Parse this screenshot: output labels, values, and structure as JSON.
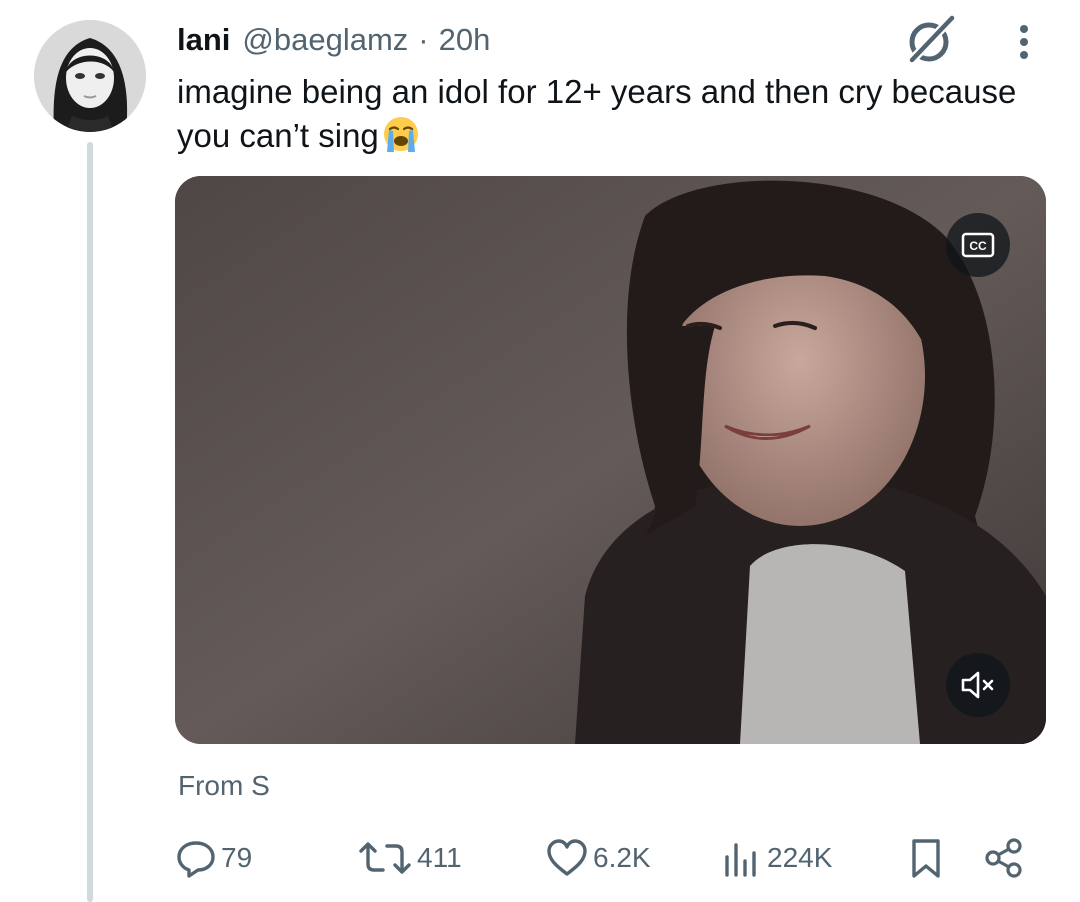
{
  "tweet": {
    "display_name": "lani",
    "handle": "@baeglamz",
    "separator": "·",
    "time": "20h",
    "text_line1": "imagine being an idol for 12+ years and then cry because",
    "text_line2": "you can’t sing",
    "emoji": "loudly-crying-face",
    "source_label": "From S"
  },
  "media": {
    "type": "video",
    "cc_label": "CC"
  },
  "actions": {
    "replies": "79",
    "reposts": "411",
    "likes": "6.2K",
    "views": "224K"
  },
  "colors": {
    "text_primary": "#0f1419",
    "text_secondary": "#536471",
    "thread_line": "#cfd9de"
  }
}
